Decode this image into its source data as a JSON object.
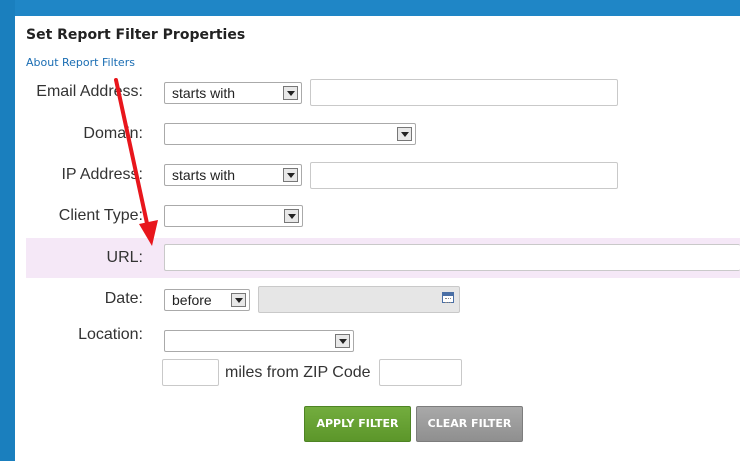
{
  "dialog": {
    "title": "Set Report Filter Properties",
    "about_link": "About Report Filters"
  },
  "fields": {
    "email": {
      "label": "Email Address:",
      "operator": "starts with",
      "value": ""
    },
    "domain": {
      "label": "Domain:",
      "value": ""
    },
    "ip": {
      "label": "IP Address:",
      "operator": "starts with",
      "value": ""
    },
    "client_type": {
      "label": "Client Type:",
      "value": ""
    },
    "url": {
      "label": "URL:",
      "value": ""
    },
    "date": {
      "label": "Date:",
      "operator": "before",
      "value": ""
    },
    "location": {
      "label": "Location:",
      "value": "",
      "miles_value": "",
      "zip_label": "miles from ZIP Code",
      "zip_value": ""
    }
  },
  "buttons": {
    "apply": "APPLY FILTER",
    "clear": "CLEAR FILTER"
  },
  "colors": {
    "apply_button": "#68a334",
    "clear_button": "#9a9a9a",
    "annotation_arrow": "#e8161c",
    "url_row_highlight": "#f5e8f7",
    "window_frame": "#1e8ed0"
  },
  "icons": {
    "dropdown": "chevron-down-icon",
    "date_picker": "calendar-icon",
    "annotation": "red-arrow-icon"
  }
}
